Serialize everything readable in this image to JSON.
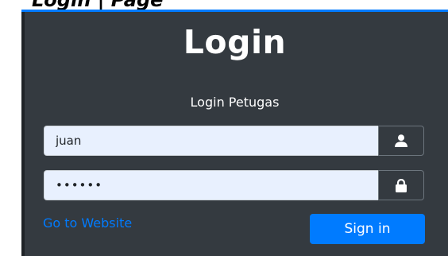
{
  "header_text": "Login | Page",
  "card": {
    "title": "Login",
    "subtitle": "Login Petugas"
  },
  "form": {
    "username_value": "juan",
    "password_value": "juan12",
    "username_icon": "user-icon",
    "password_icon": "lock-icon"
  },
  "actions": {
    "website_link": "Go to Website",
    "signin_label": "Sign in"
  },
  "colors": {
    "card_bg": "#343a40",
    "accent": "#007bff",
    "input_bg": "#e8f0fe"
  }
}
